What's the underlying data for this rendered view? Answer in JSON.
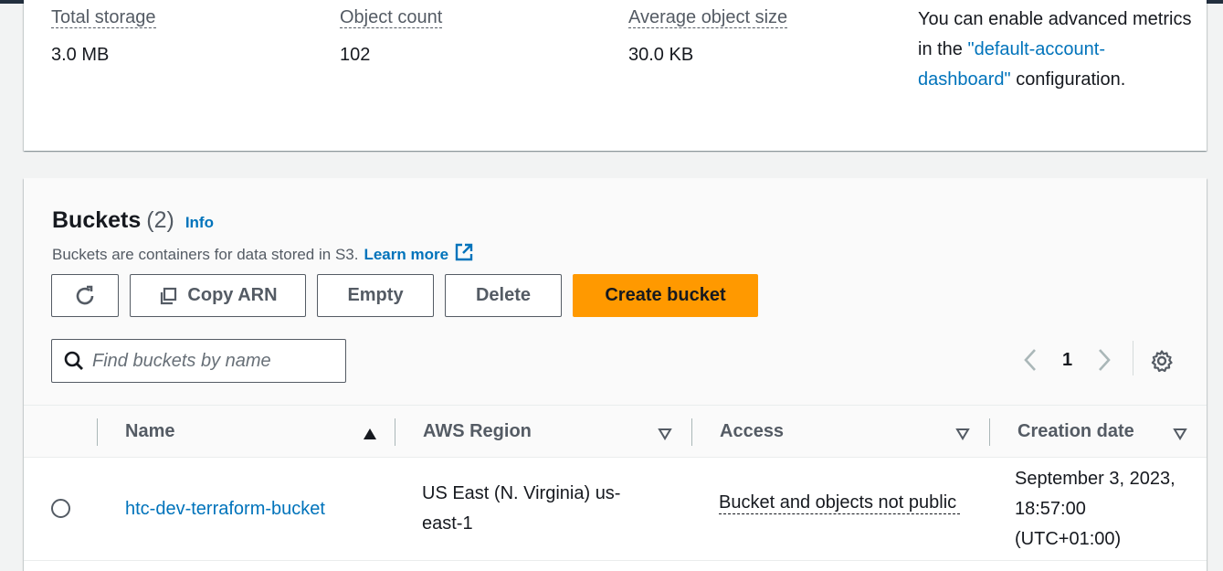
{
  "storage": {
    "metrics": [
      {
        "label": "Total storage",
        "value": "3.0 MB"
      },
      {
        "label": "Object count",
        "value": "102"
      },
      {
        "label": "Average object size",
        "value": "30.0 KB"
      }
    ],
    "note_prefix": "You can enable advanced metrics in the",
    "note_link": "\"default-account-dashboard\"",
    "note_suffix": "configuration."
  },
  "buckets": {
    "title": "Buckets",
    "count": "(2)",
    "info": "Info",
    "description": "Buckets are containers for data stored in S3.",
    "learn_more": "Learn more",
    "toolbar": {
      "refresh_icon": "refresh-icon",
      "copy_arn": "Copy ARN",
      "empty": "Empty",
      "delete": "Delete",
      "create": "Create bucket"
    },
    "search": {
      "placeholder": "Find buckets by name",
      "value": ""
    },
    "pagination": {
      "current_page": "1"
    },
    "columns": [
      "Name",
      "AWS Region",
      "Access",
      "Creation date"
    ],
    "rows": [
      {
        "name": "htc-dev-terraform-bucket",
        "region": "US East (N. Virginia) us-east-1",
        "access": "Bucket and objects not public",
        "created": "September 3, 2023, 18:57:00 (UTC+01:00)"
      }
    ]
  },
  "colors": {
    "accent": "#ff9900",
    "link": "#0073bb",
    "topbar": "#232f3e"
  }
}
